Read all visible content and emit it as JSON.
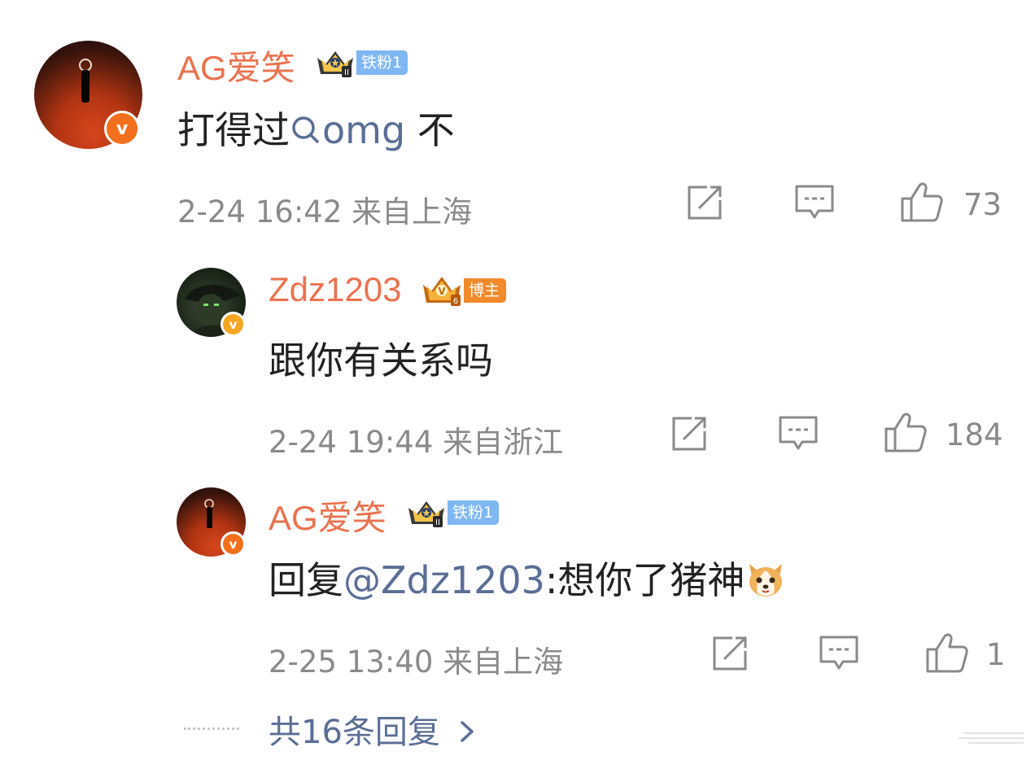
{
  "comments": [
    {
      "username": "AG爱笑",
      "badge": "铁粉1",
      "text_prefix": "打得过",
      "text_link": "omg",
      "text_suffix": " 不",
      "time": "2-24 16:42",
      "location": "来自上海",
      "likes": "73"
    },
    {
      "username": "Zdz1203",
      "badge": "博主",
      "text": "跟你有关系吗",
      "time": "2-24 19:44",
      "location": "来自浙江",
      "likes": "184"
    },
    {
      "username": "AG爱笑",
      "badge": "铁粉1",
      "reply_prefix": "回复",
      "reply_mention": "@Zdz1203",
      "reply_text": ":想你了猪神",
      "time": "2-25 13:40",
      "location": "来自上海",
      "likes": "1"
    }
  ],
  "more_replies": "共16条回复",
  "colors": {
    "username": "#eb7350",
    "link": "#5a6e96",
    "meta": "#8a8a8a",
    "fan_badge": "#7fb7f2",
    "host_badge": "#f08a2b",
    "verified_orange": "#f2701c",
    "verified_gold": "#f5a623"
  },
  "icons": [
    "verified-v-icon",
    "crown-icon",
    "search-topic-icon",
    "repost-icon",
    "comment-icon",
    "like-icon",
    "dog-emoji-icon",
    "chevron-right-icon"
  ]
}
